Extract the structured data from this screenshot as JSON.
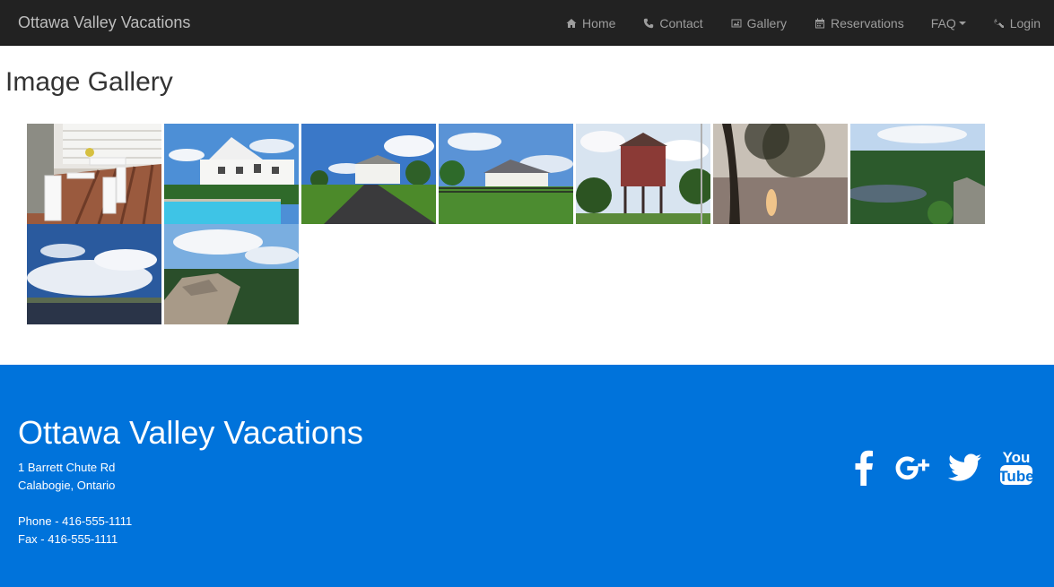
{
  "navbar": {
    "brand": "Ottawa Valley Vacations",
    "items": [
      {
        "label": "Home",
        "icon": "home-icon"
      },
      {
        "label": "Contact",
        "icon": "phone-icon"
      },
      {
        "label": "Gallery",
        "icon": "image-icon"
      },
      {
        "label": "Reservations",
        "icon": "calendar-icon"
      },
      {
        "label": "FAQ",
        "icon": "chevron-down-icon"
      },
      {
        "label": "Login",
        "icon": "key-icon"
      }
    ]
  },
  "main": {
    "title": "Image Gallery",
    "images": [
      {
        "subject": "porch-with-white-chairs"
      },
      {
        "subject": "house-with-pool"
      },
      {
        "subject": "house-driveway"
      },
      {
        "subject": "ranch-house-fence"
      },
      {
        "subject": "water-tower"
      },
      {
        "subject": "lake-sunset-tree"
      },
      {
        "subject": "forest-valley-cliff"
      },
      {
        "subject": "lake-clouds"
      },
      {
        "subject": "rock-outcrop-forest"
      }
    ]
  },
  "footer": {
    "title": "Ottawa Valley Vacations",
    "address_line1": "1 Barrett Chute Rd",
    "address_line2": "Calabogie, Ontario",
    "phone": "Phone - 416-555-1111",
    "fax": "Fax - 416-555-1111",
    "social": [
      "facebook-icon",
      "google-plus-icon",
      "twitter-icon",
      "youtube-icon"
    ],
    "youtube_text_top": "You",
    "youtube_text_bottom": "Tube"
  },
  "colors": {
    "navbar_bg": "#222222",
    "footer_bg": "#0073db"
  }
}
